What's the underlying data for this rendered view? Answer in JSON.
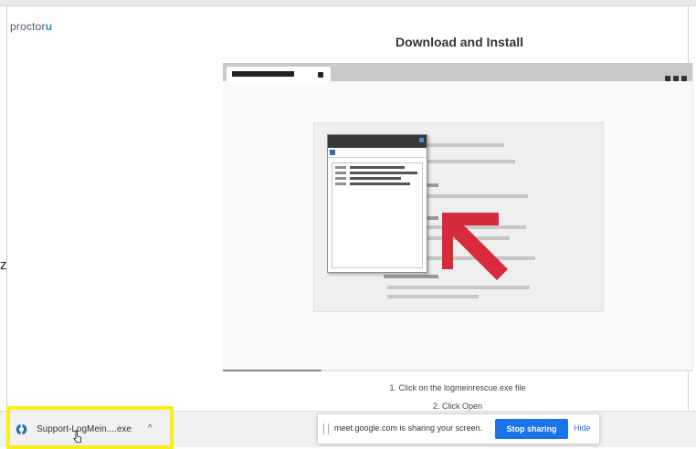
{
  "header": {
    "logo_text": "proctor",
    "logo_mark": "u",
    "edge_mark": "z"
  },
  "main": {
    "title": "Download and Install",
    "demo_progress_fraction": 0.21,
    "steps": [
      "1. Click on the logmeinrescue.exe file",
      "2. Click Open"
    ]
  },
  "download_bar": {
    "file_label": "Support-LogMein....exe",
    "file_icon": "logmein-rescue-icon",
    "caret": "^",
    "highlight_color": "#f7ef1a"
  },
  "screen_share_bar": {
    "message": "meet.google.com is sharing your screen.",
    "stop_label": "Stop sharing",
    "hide_label": "Hide",
    "accent": "#1a73e8"
  },
  "colors": {
    "arrow": "#d62b3a"
  }
}
